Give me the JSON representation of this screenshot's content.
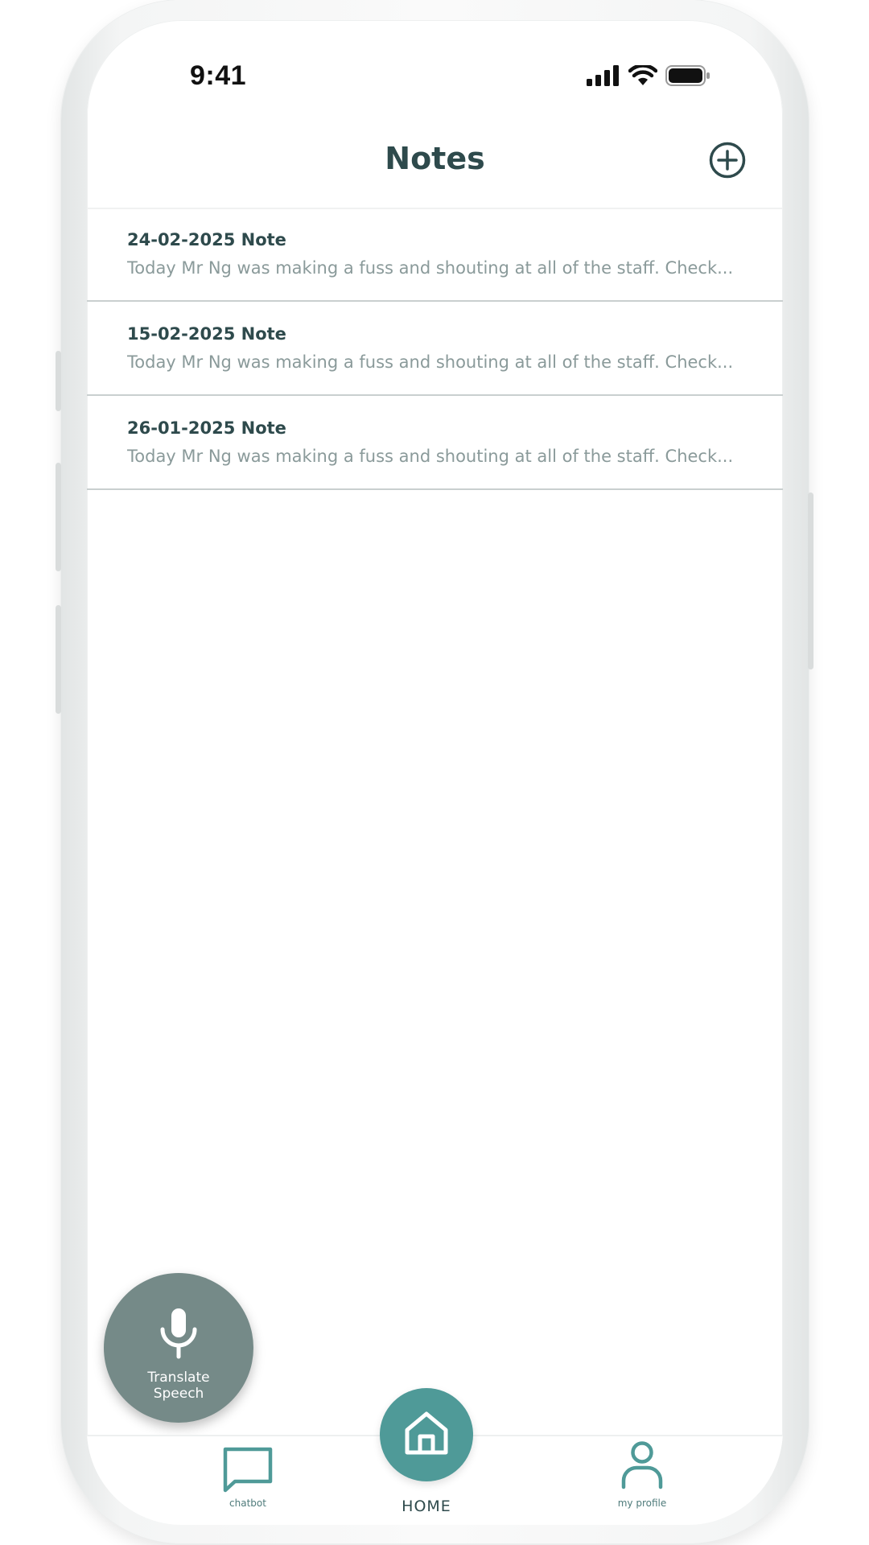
{
  "status_bar": {
    "time": "9:41"
  },
  "header": {
    "title": "Notes",
    "add_icon": "plus-circle-icon"
  },
  "notes": [
    {
      "title": "24-02-2025 Note",
      "preview": "Today Mr Ng was making a fuss and shouting at all of the staff. Check..."
    },
    {
      "title": "15-02-2025 Note",
      "preview": "Today Mr Ng was making a fuss and shouting at all of the staff. Check..."
    },
    {
      "title": "26-01-2025 Note",
      "preview": "Today Mr Ng was making a fuss and shouting at all of the staff. Check..."
    }
  ],
  "translate_fab": {
    "line1": "Translate",
    "line2": "Speech",
    "icon": "microphone-icon"
  },
  "bottom_nav": {
    "chatbot_label": "chatbot",
    "home_label": "HOME",
    "profile_label": "my profile"
  },
  "colors": {
    "primary_dark": "#2e4a4c",
    "accent_teal": "#4f9a98",
    "fab_grey": "#758a88",
    "muted_text": "#8a9a9a",
    "divider": "#c9cfcf"
  }
}
